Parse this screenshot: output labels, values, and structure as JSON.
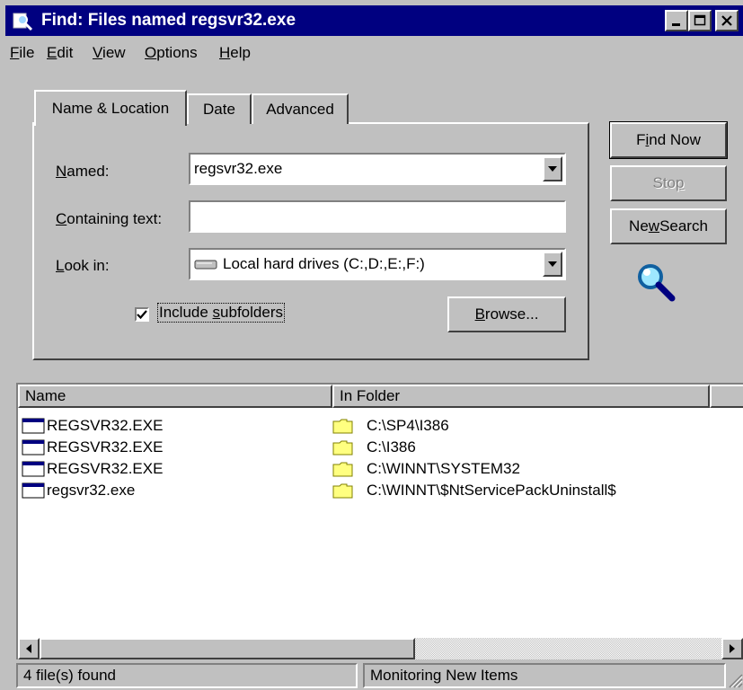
{
  "window": {
    "title": "Find: Files named regsvr32.exe",
    "title_bar_color": "#000080"
  },
  "title_buttons": {
    "minimize_icon": "minimize-icon",
    "maximize_icon": "maximize-icon",
    "close_icon": "close-icon"
  },
  "menu": [
    {
      "label": "File",
      "key": "F",
      "rest": "ile"
    },
    {
      "label": "Edit",
      "key": "E",
      "rest": "dit"
    },
    {
      "label": "View",
      "key": "V",
      "rest": "iew"
    },
    {
      "label": "Options",
      "key": "O",
      "rest": "ptions"
    },
    {
      "label": "Help",
      "key": "H",
      "rest": "elp"
    }
  ],
  "tabs": [
    {
      "label": "Name & Location",
      "active": true
    },
    {
      "label": "Date",
      "active": false
    },
    {
      "label": "Advanced",
      "active": false
    }
  ],
  "form": {
    "named": {
      "label_key": "N",
      "label_rest": "amed:",
      "value": "regsvr32.exe"
    },
    "containing": {
      "label_key": "C",
      "label_rest": "ontaining text:",
      "value": ""
    },
    "look_in": {
      "label_key": "L",
      "label_rest": "ook in:",
      "value": "Local hard drives (C:,D:,E:,F:)"
    },
    "include_subfolders": {
      "pre": "Include ",
      "key": "s",
      "rest": "ubfolders",
      "checked": true
    },
    "browse": {
      "key": "B",
      "rest": "rowse..."
    }
  },
  "actions": {
    "find_now": {
      "pre": "F",
      "key": "i",
      "rest": "nd Now"
    },
    "stop": {
      "pre": "Sto",
      "key": "p",
      "rest": "",
      "disabled": true
    },
    "new_search": {
      "pre": "Ne",
      "key": "w",
      "rest": " Search"
    }
  },
  "results": {
    "columns": [
      "Name",
      "In Folder"
    ],
    "rows": [
      {
        "name": "REGSVR32.EXE",
        "folder": "C:\\SP4\\I386"
      },
      {
        "name": "REGSVR32.EXE",
        "folder": "C:\\I386"
      },
      {
        "name": "REGSVR32.EXE",
        "folder": "C:\\WINNT\\SYSTEM32"
      },
      {
        "name": "regsvr32.exe",
        "folder": "C:\\WINNT\\$NtServicePackUninstall$"
      }
    ]
  },
  "status": {
    "count": "4 file(s) found",
    "monitor": "Monitoring New Items"
  }
}
